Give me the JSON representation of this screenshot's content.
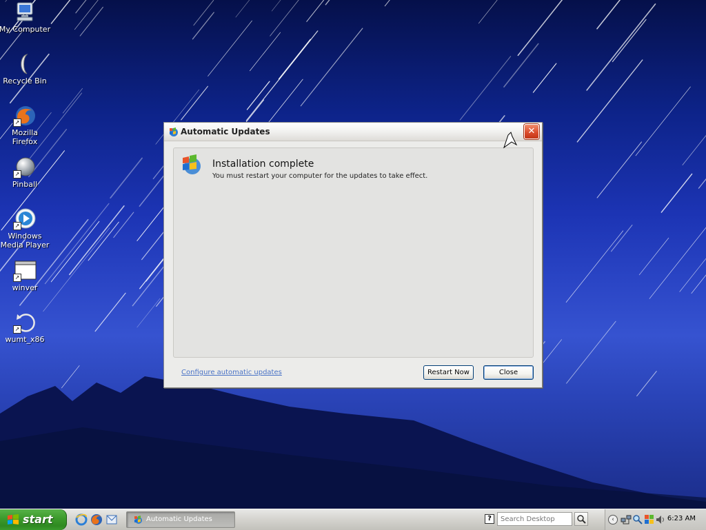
{
  "desktop": {
    "icons": [
      {
        "label": "My Computer",
        "icon": "my-computer-icon"
      },
      {
        "label": "Recycle Bin",
        "icon": "recycle-bin-icon"
      },
      {
        "label": "Mozilla Firefox",
        "icon": "firefox-icon"
      },
      {
        "label": "Pinball",
        "icon": "pinball-icon"
      },
      {
        "label": "Windows Media Player",
        "icon": "media-player-icon"
      },
      {
        "label": "winver",
        "icon": "window-app-icon"
      },
      {
        "label": "wumt_x86",
        "icon": "refresh-arrow-icon"
      }
    ]
  },
  "dialog": {
    "title": "Automatic Updates",
    "heading": "Installation complete",
    "message": "You must restart your computer for the updates to take effect.",
    "link_label": "Configure automatic updates",
    "restart_label": "Restart Now",
    "close_label": "Close",
    "close_glyph": "✕"
  },
  "taskbar": {
    "start_label": "start",
    "quick_launch": [
      "internet-explorer-icon",
      "firefox-icon",
      "outlook-express-icon"
    ],
    "task_label": "Automatic Updates",
    "help_glyph": "?",
    "search_placeholder": "Search Desktop",
    "tray_chevron": "‹",
    "tray_icons": [
      "network-icon",
      "search-tray-icon",
      "security-icon",
      "volume-icon"
    ],
    "clock": "6:23 AM"
  },
  "colors": {
    "xp_green": "#3c9a2c",
    "dialog_bg": "#ececea",
    "link_blue": "#4a73c6",
    "close_red": "#d9492a"
  }
}
